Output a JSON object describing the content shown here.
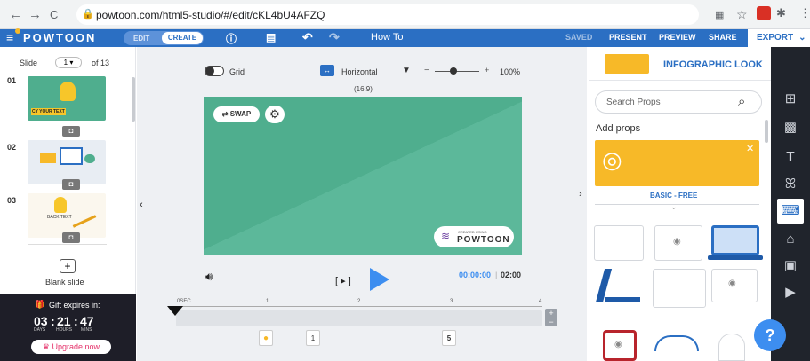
{
  "browser": {
    "url": "powtoon.com/html5-studio/#/edit/cKL4bU4AFZQ",
    "back_icon": "←",
    "forward_icon": "→",
    "reload_icon": "C"
  },
  "toolbar": {
    "logo": "POWTOON",
    "edit_label": "EDIT",
    "create_label": "CREATE",
    "help_icon": "?",
    "undo_icon": "↶",
    "redo_icon": "↷",
    "how_to": "How To",
    "saved": "SAVED",
    "present": "PRESENT",
    "preview": "PREVIEW",
    "share": "SHARE",
    "export": "EXPORT"
  },
  "slides": {
    "slide_label": "Slide",
    "current": "1",
    "total": "of 13",
    "items": [
      {
        "num": "01"
      },
      {
        "num": "02"
      },
      {
        "num": "03"
      }
    ],
    "blank_slide": "Blank slide",
    "thumb1_text": "CY YOUR TEXT",
    "thumb3_text": "BACK TEXT"
  },
  "gift": {
    "title": "Gift expires in:",
    "days": "03",
    "hours": "21",
    "mins": "47",
    "days_label": "DAYS",
    "hours_label": "HOURS",
    "mins_label": "MINS",
    "upgrade": "Upgrade now"
  },
  "canvas": {
    "grid_label": "Grid",
    "orientation": "Horizontal",
    "ratio": "(16:9)",
    "zoom": "100%",
    "swap": "SWAP",
    "watermark_top": "CREATED USING",
    "watermark": "POWTOON"
  },
  "player": {
    "time_current": "00:00:00",
    "time_total": "02:00",
    "ticks": [
      "0SEC",
      "1",
      "2",
      "3",
      "4"
    ],
    "marker_1": "1",
    "marker_5": "5"
  },
  "props": {
    "look": "INFOGRAPHIC LOOK",
    "search_placeholder": "Search Props",
    "add_props": "Add props",
    "basic_free": "BASIC - FREE"
  },
  "colors": {
    "brand_blue": "#2b6fc3",
    "canvas_green": "#4fae8e",
    "play_blue": "#3d8ef0",
    "props_yellow": "#f7b928",
    "upgrade_pink": "#e5336b"
  }
}
